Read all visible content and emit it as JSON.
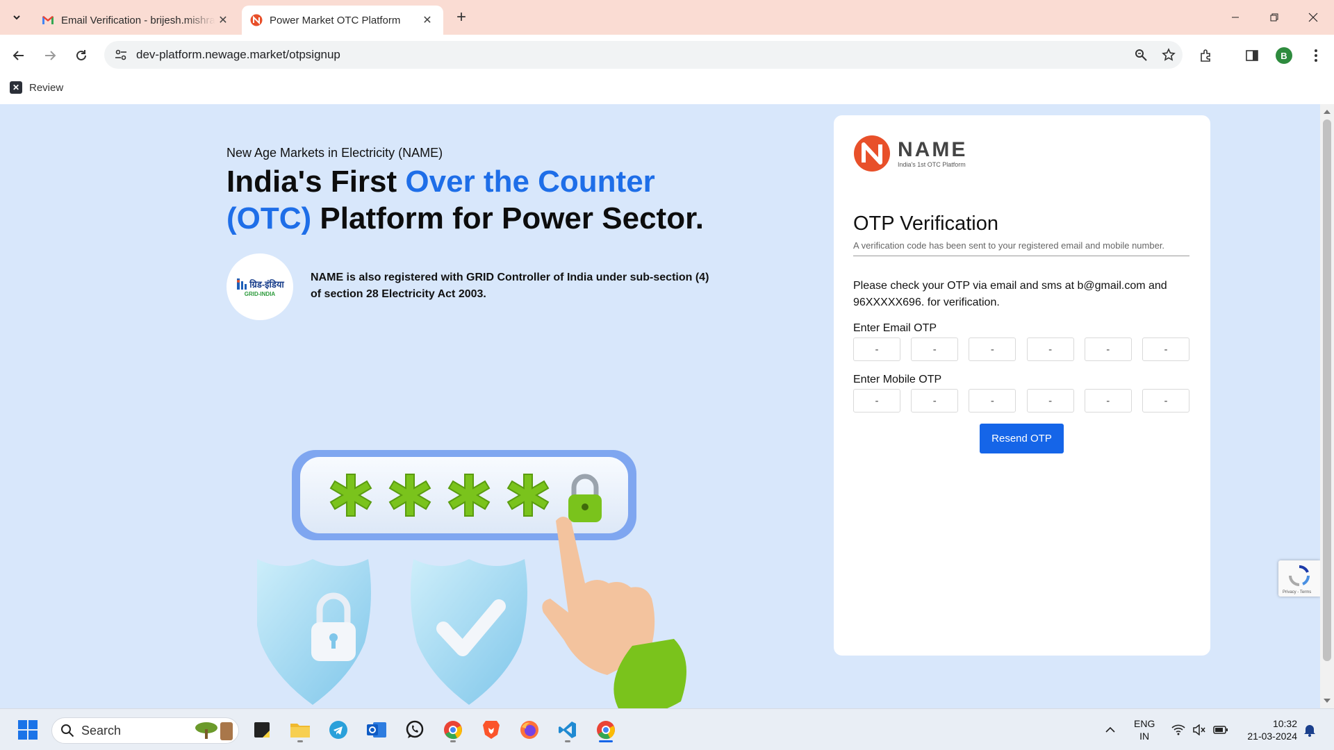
{
  "browser": {
    "tabs": [
      {
        "title": "Email Verification - brijesh.mishra",
        "favicon": "gmail-icon"
      },
      {
        "title": "Power Market OTC Platform",
        "favicon": "name-logo-icon"
      }
    ],
    "url": "dev-platform.newage.market/otpsignup",
    "profile_initial": "B",
    "bookmark": "Review"
  },
  "hero": {
    "eyebrow": "New Age Markets in Electricity (NAME)",
    "headline_part1": "India's First ",
    "headline_highlight": "Over the Counter (OTC)",
    "headline_part2": " Platform for Power Sector.",
    "grid_note": "NAME is also registered with GRID Controller of India under sub-section (4) of section 28 Electricity Act 2003.",
    "grid_logo_text": "ग्रिड-इंडिया",
    "grid_logo_sub": "GRID-INDIA"
  },
  "card": {
    "logo_text": "NAME",
    "logo_tagline": "India's 1st OTC Platform",
    "title": "OTP Verification",
    "subtitle": "A verification code has been sent to your registered email and mobile number.",
    "message": "Please check your OTP via email and sms at b@gmail.com and 96XXXXX696. for verification.",
    "email_otp_label": "Enter Email OTP",
    "mobile_otp_label": "Enter Mobile OTP",
    "otp_placeholder": "-",
    "resend_label": "Resend OTP"
  },
  "recaptcha": {
    "terms": "Privacy - Terms"
  },
  "taskbar": {
    "search_label": "Search",
    "lang_line1": "ENG",
    "lang_line2": "IN",
    "time": "10:32",
    "date": "21-03-2024"
  },
  "colors": {
    "accent": "#1e6ee8",
    "button": "#1565e8",
    "page_bg": "#d8e7fb",
    "tabbar_bg": "#fadcd3"
  }
}
